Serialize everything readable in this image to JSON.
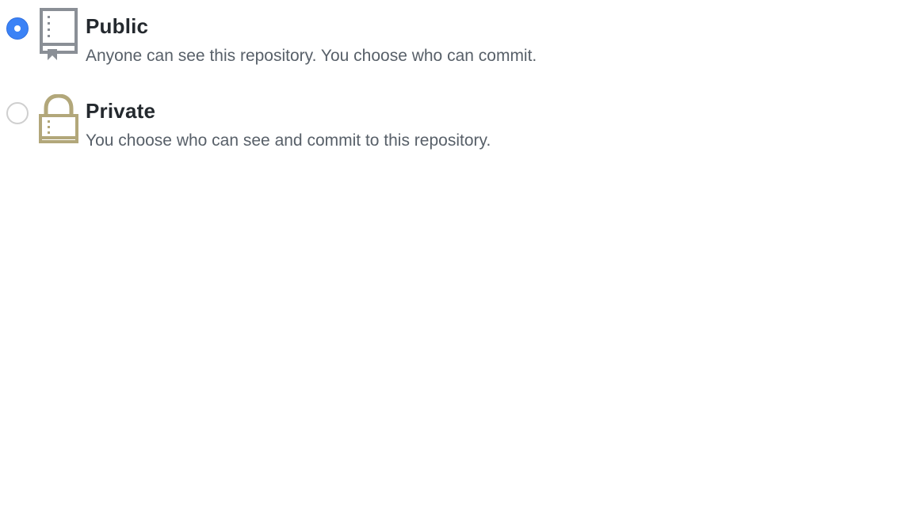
{
  "visibility": {
    "options": [
      {
        "label": "Public",
        "description": "Anyone can see this repository. You choose who can commit.",
        "checked": true,
        "icon": "repo-book-icon"
      },
      {
        "label": "Private",
        "description": "You choose who can see and commit to this repository.",
        "checked": false,
        "icon": "lock-icon"
      }
    ]
  },
  "colors": {
    "radio_selected": "#3b82f6",
    "public_icon": "#8a8f96",
    "private_icon": "#b2a77a",
    "title_text": "#24292e",
    "description_text": "#586069"
  }
}
